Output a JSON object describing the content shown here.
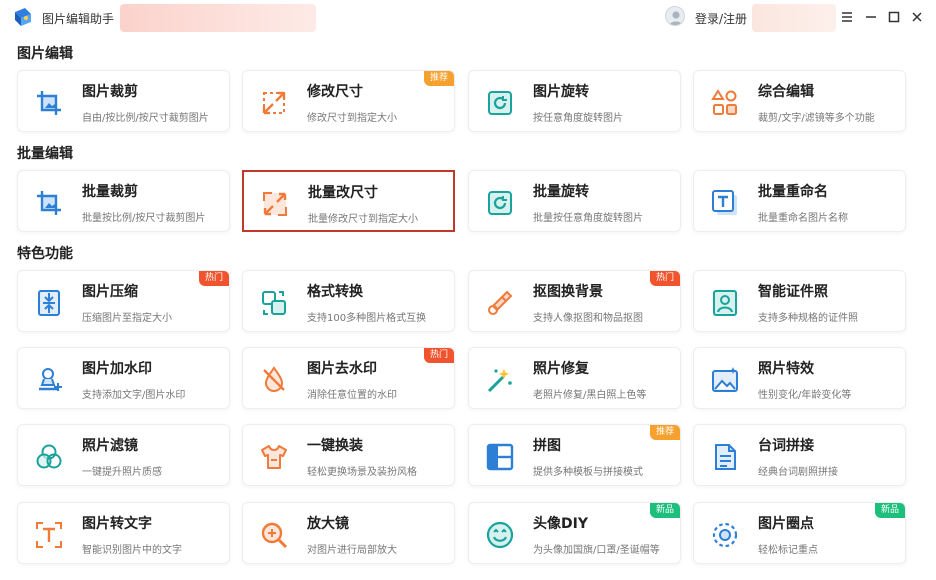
{
  "app": {
    "title": "图片编辑助手",
    "login_label": "登录/注册"
  },
  "sections": [
    {
      "title": "图片编辑"
    },
    {
      "title": "批量编辑"
    },
    {
      "title": "特色功能"
    }
  ],
  "cards": [
    {
      "title": "图片裁剪",
      "desc": "自由/按比例/按尺寸裁剪图片",
      "icon": "crop-icon",
      "badge": ""
    },
    {
      "title": "修改尺寸",
      "desc": "修改尺寸到指定大小",
      "icon": "resize-icon",
      "badge": "推荐"
    },
    {
      "title": "图片旋转",
      "desc": "按任意角度旋转图片",
      "icon": "rotate-icon",
      "badge": ""
    },
    {
      "title": "综合编辑",
      "desc": "裁剪/文字/滤镜等多个功能",
      "icon": "shapes-icon",
      "badge": ""
    },
    {
      "title": "批量裁剪",
      "desc": "批量按比例/按尺寸裁剪图片",
      "icon": "batch-crop-icon",
      "badge": ""
    },
    {
      "title": "批量改尺寸",
      "desc": "批量修改尺寸到指定大小",
      "icon": "batch-resize-icon",
      "badge": ""
    },
    {
      "title": "批量旋转",
      "desc": "批量按任意角度旋转图片",
      "icon": "batch-rotate-icon",
      "badge": ""
    },
    {
      "title": "批量重命名",
      "desc": "批量重命名图片名称",
      "icon": "rename-icon",
      "badge": ""
    },
    {
      "title": "图片压缩",
      "desc": "压缩图片至指定大小",
      "icon": "compress-icon",
      "badge": "热门"
    },
    {
      "title": "格式转换",
      "desc": "支持100多种图片格式互换",
      "icon": "convert-icon",
      "badge": ""
    },
    {
      "title": "抠图换背景",
      "desc": "支持人像抠图和物品抠图",
      "icon": "cutout-icon",
      "badge": "热门"
    },
    {
      "title": "智能证件照",
      "desc": "支持多种规格的证件照",
      "icon": "id-photo-icon",
      "badge": ""
    },
    {
      "title": "图片加水印",
      "desc": "支持添加文字/图片水印",
      "icon": "add-watermark-icon",
      "badge": ""
    },
    {
      "title": "图片去水印",
      "desc": "消除任意位置的水印",
      "icon": "remove-watermark-icon",
      "badge": "热门"
    },
    {
      "title": "照片修复",
      "desc": "老照片修复/黑白照上色等",
      "icon": "magic-wand-icon",
      "badge": ""
    },
    {
      "title": "照片特效",
      "desc": "性别变化/年龄变化等",
      "icon": "photo-effect-icon",
      "badge": ""
    },
    {
      "title": "照片滤镜",
      "desc": "一键提升照片质感",
      "icon": "filter-icon",
      "badge": ""
    },
    {
      "title": "一键换装",
      "desc": "轻松更换场景及装扮风格",
      "icon": "shirt-icon",
      "badge": ""
    },
    {
      "title": "拼图",
      "desc": "提供多种模板与拼接模式",
      "icon": "collage-icon",
      "badge": "推荐"
    },
    {
      "title": "台词拼接",
      "desc": "经典台词剧照拼接",
      "icon": "subtitle-stitch-icon",
      "badge": ""
    },
    {
      "title": "图片转文字",
      "desc": "智能识别图片中的文字",
      "icon": "ocr-icon",
      "badge": ""
    },
    {
      "title": "放大镜",
      "desc": "对图片进行局部放大",
      "icon": "magnifier-icon",
      "badge": ""
    },
    {
      "title": "头像DIY",
      "desc": "为头像加国旗/口罩/圣诞帽等",
      "icon": "avatar-diy-icon",
      "badge": "新品"
    },
    {
      "title": "图片圈点",
      "desc": "轻松标记重点",
      "icon": "mark-icon",
      "badge": "新品"
    }
  ],
  "colors": {
    "accent_blue": "#2d7fd6",
    "teal": "#1aa29c",
    "orange": "#f07a3a",
    "selected_border": "#c0392b"
  }
}
